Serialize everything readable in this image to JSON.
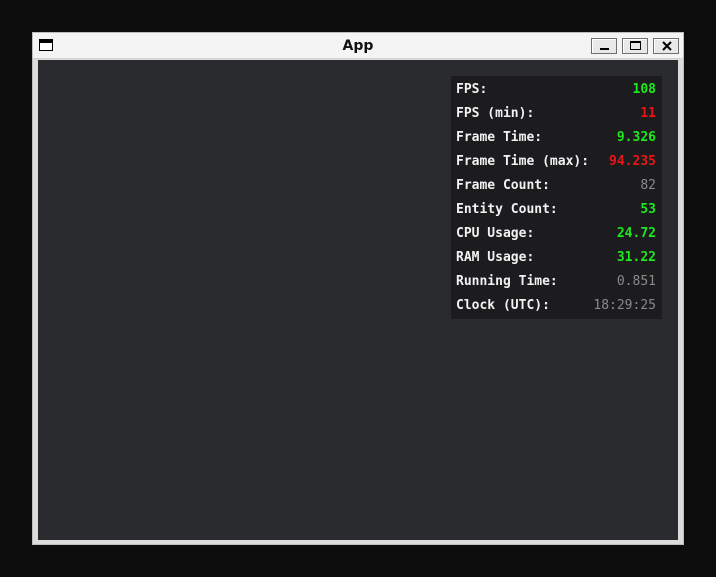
{
  "window": {
    "title": "App"
  },
  "colors": {
    "good": "#1ee81e",
    "bad": "#e81616",
    "neutral": "#8a8a8a",
    "background": "#2a2b2f"
  },
  "titlebar": {
    "icon": "app-window-icon",
    "buttons": [
      "minimize-icon",
      "maximize-icon",
      "close-icon"
    ]
  },
  "stats": [
    {
      "label": "FPS:",
      "value": "108",
      "status": "good"
    },
    {
      "label": "FPS (min):",
      "value": "11",
      "status": "bad"
    },
    {
      "label": "Frame Time:",
      "value": "9.326",
      "status": "good"
    },
    {
      "label": "Frame Time (max):",
      "value": "94.235",
      "status": "bad"
    },
    {
      "label": "Frame Count:",
      "value": "82",
      "status": "neutral"
    },
    {
      "label": "Entity Count:",
      "value": "53",
      "status": "good"
    },
    {
      "label": "CPU Usage:",
      "value": "24.72",
      "status": "good"
    },
    {
      "label": "RAM Usage:",
      "value": "31.22",
      "status": "good"
    },
    {
      "label": "Running Time:",
      "value": "0.851",
      "status": "neutral"
    },
    {
      "label": "Clock (UTC):",
      "value": "18:29:25",
      "status": "neutral"
    }
  ]
}
